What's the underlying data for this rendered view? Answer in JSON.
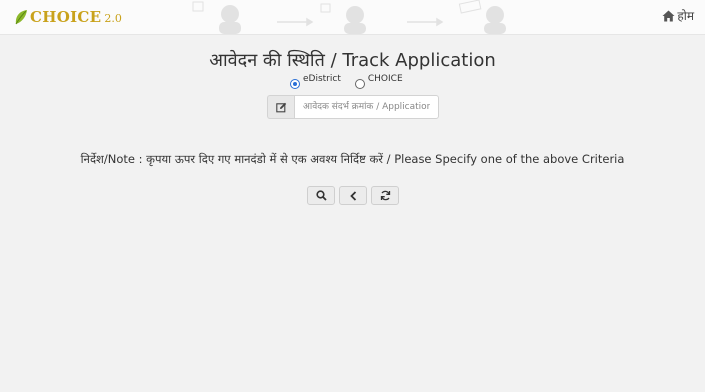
{
  "header": {
    "brand": "CHOICE",
    "version": "2.0",
    "home_label": "होम",
    "brand_color": "#c9a21b",
    "icons": {
      "logo": "leaf-icon",
      "home": "home-icon"
    }
  },
  "page": {
    "title": "आवेदन की स्थिति / Track Application"
  },
  "search_type": {
    "options": [
      {
        "label": "eDistrict",
        "checked": true
      },
      {
        "label": "CHOICE",
        "checked": false
      }
    ]
  },
  "reference_input": {
    "placeholder": "आवेदक संदर्भ क्रमांक / Application Reference Number",
    "value": "",
    "icon": "edit-icon"
  },
  "note": "निर्देश/Note : कृपया ऊपर दिए गए मानदंडो में से एक अवश्य निर्दिष्ट करें / Please Specify one of the above Criteria",
  "actions": [
    {
      "icon": "search-icon"
    },
    {
      "icon": "back-icon"
    },
    {
      "icon": "refresh-icon"
    }
  ],
  "colors": {
    "radio_accent": "#2a6fd6",
    "background": "#f2f2f2"
  }
}
